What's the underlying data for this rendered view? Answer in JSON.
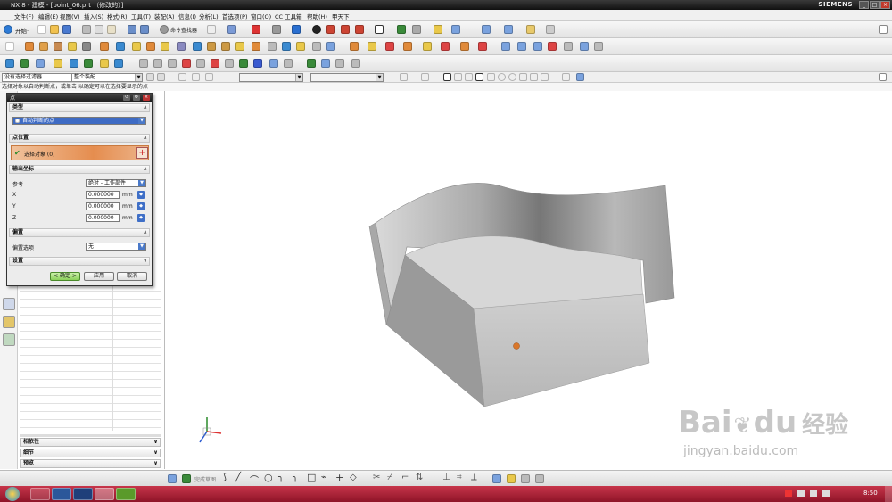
{
  "window": {
    "title": "NX 8 - 建模 - [point_06.prt （修改的）]",
    "brand": "SIEMENS",
    "controls": [
      "_",
      "□",
      "×"
    ]
  },
  "menu": [
    "文件(F)",
    "编辑(E)",
    "视图(V)",
    "插入(S)",
    "格式(R)",
    "工具(T)",
    "装配(A)",
    "信息(I)",
    "分析(L)",
    "首选项(P)",
    "窗口(O)",
    "CC 工具箱",
    "帮助(H)",
    "甲天下"
  ],
  "toolbar": {
    "start_label": "开始·",
    "command_finder": "命令查找器"
  },
  "selection": {
    "filter": "没有选择过滤器",
    "scope": "整个装配"
  },
  "cue": "选择对象以自动判断点，或单击·以确定可以在选择要显示的点",
  "dialog": {
    "title": "点",
    "type_header": "类型",
    "type_value": "自动判断的点",
    "point_loc_header": "点位置",
    "select_object": "选择对象 (0)",
    "output_header": "输出坐标",
    "reference_label": "参考",
    "reference_value": "绝对 - 工作部件",
    "x_label": "X",
    "x_value": "0.000000",
    "x_unit": "mm",
    "y_label": "Y",
    "y_value": "0.000000",
    "y_unit": "mm",
    "z_label": "Z",
    "z_value": "0.000000",
    "z_unit": "mm",
    "offset_header": "偏置",
    "offset_label": "偏置选项",
    "offset_value": "无",
    "settings_header": "设置",
    "ok": "< 确定 >",
    "apply": "应用",
    "cancel": "取消"
  },
  "navigator_sections": [
    "相依性",
    "细节",
    "预览"
  ],
  "status": {
    "sketch_label": "完成草图"
  },
  "watermark": {
    "line1": "Bai",
    "line2": "du",
    "line3": "经验",
    "url": "jingyan.baidu.com"
  },
  "clock": "8:50",
  "colors": {
    "titlebar": "#1a1a1a",
    "dialog_accent": "#e48a4f",
    "taskbar": "#b0283c",
    "model_gray": "#bdbdbd"
  }
}
